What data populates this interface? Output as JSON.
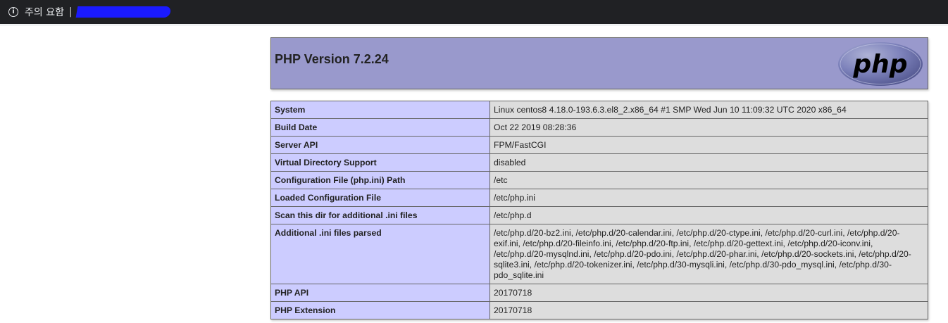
{
  "browser": {
    "security_label": "주의 요함",
    "separator": "|"
  },
  "header": {
    "title": "PHP Version 7.2.24",
    "logo_text": "php"
  },
  "rows": [
    {
      "key": "System",
      "value": "Linux centos8 4.18.0-193.6.3.el8_2.x86_64 #1 SMP Wed Jun 10 11:09:32 UTC 2020 x86_64"
    },
    {
      "key": "Build Date",
      "value": "Oct 22 2019 08:28:36"
    },
    {
      "key": "Server API",
      "value": "FPM/FastCGI"
    },
    {
      "key": "Virtual Directory Support",
      "value": "disabled"
    },
    {
      "key": "Configuration File (php.ini) Path",
      "value": "/etc"
    },
    {
      "key": "Loaded Configuration File",
      "value": "/etc/php.ini"
    },
    {
      "key": "Scan this dir for additional .ini files",
      "value": "/etc/php.d"
    },
    {
      "key": "Additional .ini files parsed",
      "value": "/etc/php.d/20-bz2.ini, /etc/php.d/20-calendar.ini, /etc/php.d/20-ctype.ini, /etc/php.d/20-curl.ini, /etc/php.d/20-exif.ini, /etc/php.d/20-fileinfo.ini, /etc/php.d/20-ftp.ini, /etc/php.d/20-gettext.ini, /etc/php.d/20-iconv.ini, /etc/php.d/20-mysqlnd.ini, /etc/php.d/20-pdo.ini, /etc/php.d/20-phar.ini, /etc/php.d/20-sockets.ini, /etc/php.d/20-sqlite3.ini, /etc/php.d/20-tokenizer.ini, /etc/php.d/30-mysqli.ini, /etc/php.d/30-pdo_mysql.ini, /etc/php.d/30-pdo_sqlite.ini"
    },
    {
      "key": "PHP API",
      "value": "20170718"
    },
    {
      "key": "PHP Extension",
      "value": "20170718"
    }
  ],
  "colors": {
    "header_bg": "#9999cc",
    "key_bg": "#ccccff",
    "value_bg": "#dddddd",
    "addrbar_bg": "#202124"
  }
}
